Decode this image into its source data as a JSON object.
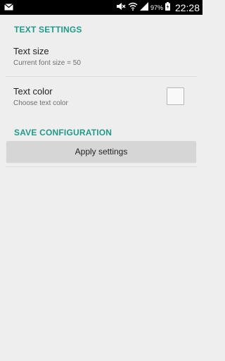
{
  "status_bar": {
    "battery_percent": "97%",
    "time": "22:28",
    "icons": [
      "mail-icon",
      "mute-icon",
      "wifi-icon",
      "signal-icon",
      "battery-icon"
    ]
  },
  "sections": {
    "text_settings": {
      "header": "TEXT SETTINGS",
      "text_size": {
        "title": "Text size",
        "summary": "Current font size = 50"
      },
      "text_color": {
        "title": "Text color",
        "summary": "Choose text color",
        "checked": false
      }
    },
    "save_configuration": {
      "header": "SAVE CONFIGURATION",
      "apply_button": "Apply settings"
    }
  },
  "colors": {
    "accent": "#1f9a8a",
    "background": "#eeeeee",
    "status_bar": "#000000",
    "button": "#d6d6d6"
  }
}
